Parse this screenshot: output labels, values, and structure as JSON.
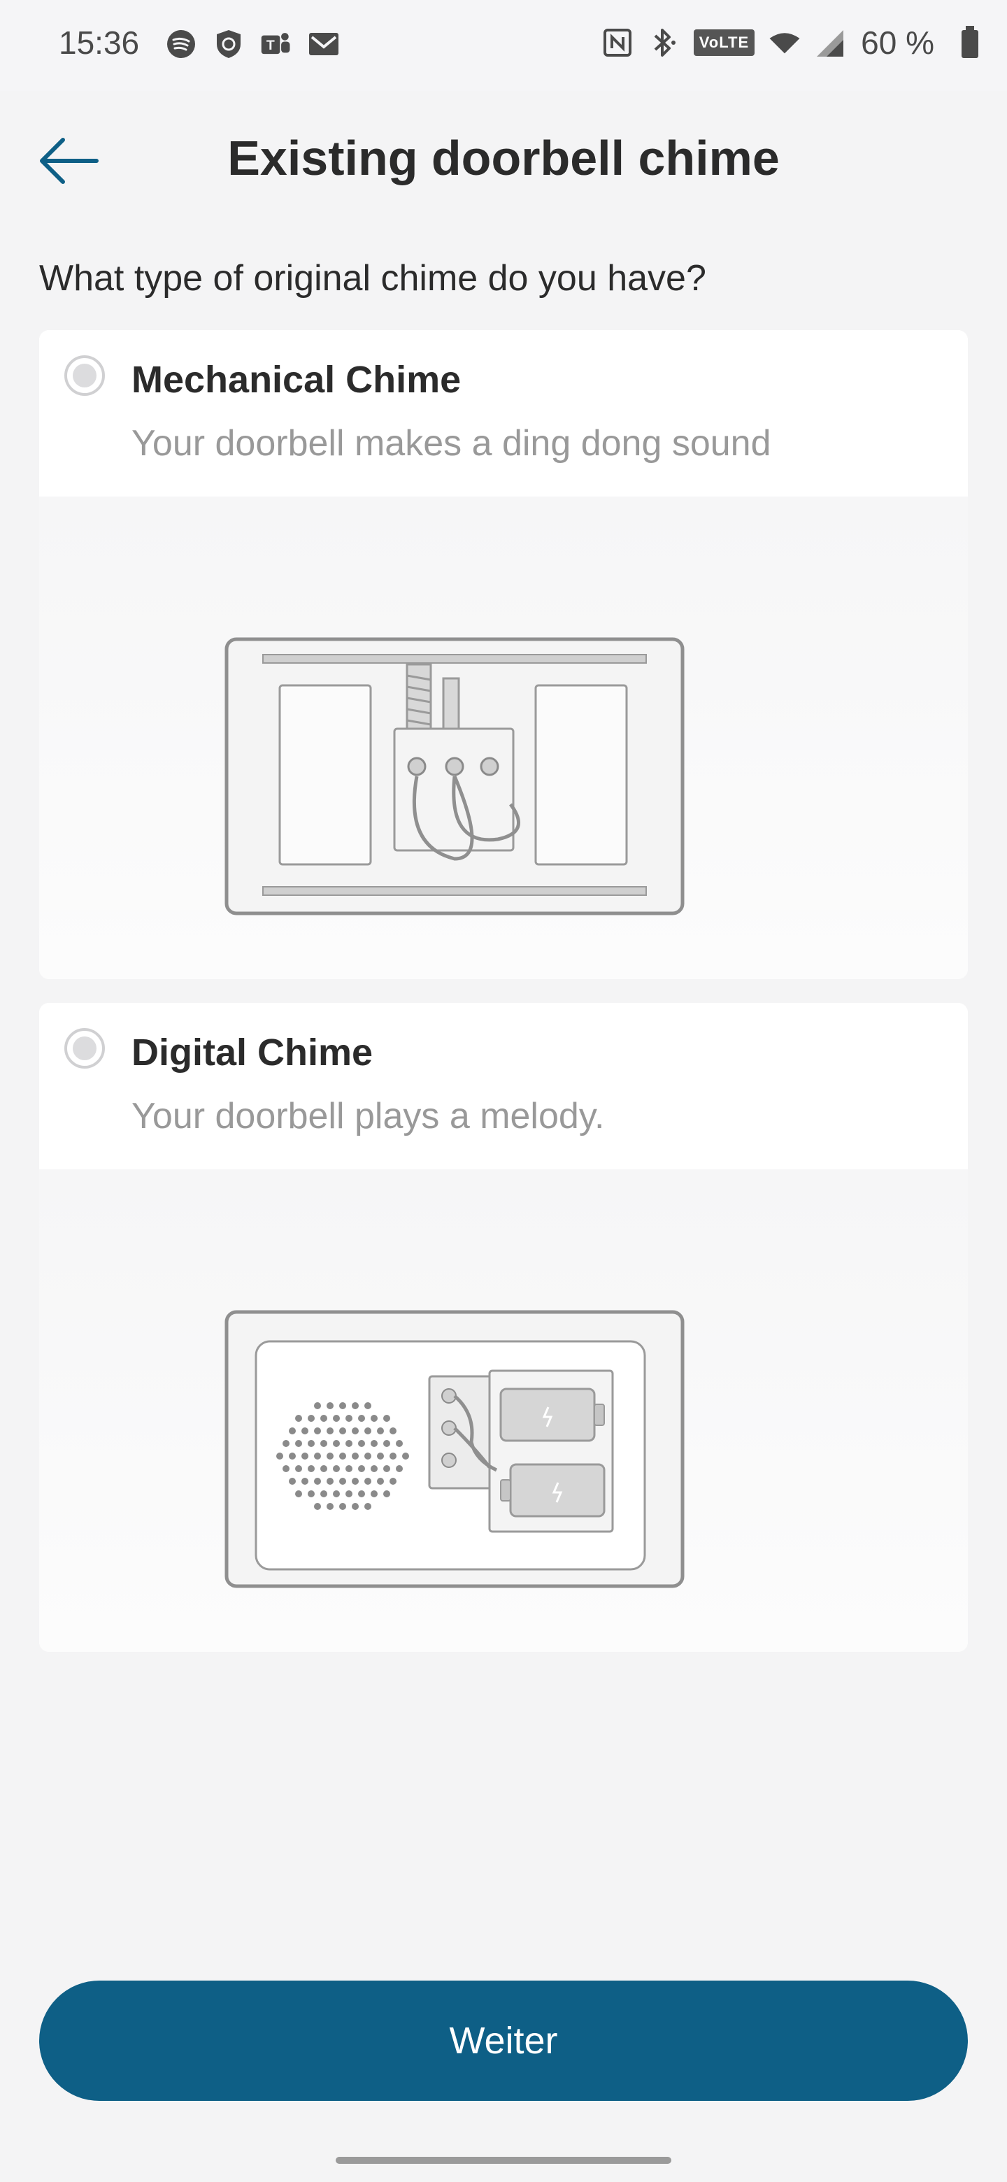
{
  "status_bar": {
    "time": "15:36",
    "battery": "60 %",
    "volte": "VoLTE",
    "icons_left": [
      "spotify-icon",
      "shield-icon",
      "teams-icon",
      "gmail-icon"
    ],
    "icons_right": [
      "nfc-icon",
      "bluetooth-icon",
      "volte-icon",
      "wifi-icon",
      "signal-icon",
      "battery-icon"
    ]
  },
  "header": {
    "title": "Existing doorbell chime",
    "back_icon": "arrow-left-icon"
  },
  "question": "What type of original chime do you have?",
  "options": [
    {
      "title": "Mechanical Chime",
      "description": "Your doorbell makes a ding dong sound",
      "selected": false,
      "illustration": "mechanical-chime-illustration"
    },
    {
      "title": "Digital Chime",
      "description": "Your doorbell plays a melody.",
      "selected": false,
      "illustration": "digital-chime-illustration"
    }
  ],
  "primary_button": {
    "label": "Weiter"
  },
  "colors": {
    "accent": "#0e5f86",
    "background": "#f4f4f5",
    "card": "#ffffff",
    "muted_text": "#999999"
  }
}
